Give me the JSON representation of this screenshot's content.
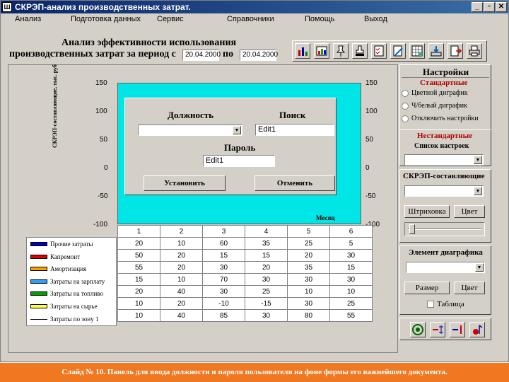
{
  "window": {
    "title": "СКРЭП-анализ производственных затрат.",
    "icon": "app-icon"
  },
  "menu": [
    "Анализ",
    "Подготовка данных",
    "Сервис",
    "Справочники",
    "Помощь",
    "Выход"
  ],
  "header": {
    "line1": "Анализ эффективности использования",
    "line2": "производственных затрат за период с",
    "to_label": "по",
    "date_from": "20.04.2000",
    "date_to": "20.04.2000"
  },
  "toolbar_icons": [
    "chart-bar-icon",
    "chart-color-icon",
    "pin-icon",
    "stamp-icon",
    "checklist-icon",
    "edit-doc-icon",
    "table-icon",
    "export-icon",
    "import-icon",
    "print-icon"
  ],
  "chart": {
    "ylabel": "СКРЭП-составляющие, тыс. руб",
    "xlabel": "Месяц",
    "yticks": [
      "150",
      "100",
      "50",
      "0",
      "-50",
      "-100"
    ],
    "yticks_right": [
      "150",
      "100",
      "50",
      "0",
      "-50",
      "-100"
    ]
  },
  "chart_data": {
    "type": "table",
    "x": [
      "1",
      "2",
      "3",
      "4",
      "5",
      "6"
    ],
    "series": [
      {
        "name": "Прочие затраты",
        "color": "#0000c0",
        "values": [
          20,
          10,
          60,
          35,
          25,
          5
        ]
      },
      {
        "name": "Капремонт",
        "color": "#e00000",
        "values": [
          50,
          20,
          15,
          15,
          20,
          30
        ]
      },
      {
        "name": "Амортизация",
        "color": "#ffa000",
        "values": [
          55,
          20,
          30,
          20,
          35,
          15
        ]
      },
      {
        "name": "Затраты на зарплату",
        "color": "#30a0ff",
        "values": [
          15,
          10,
          70,
          30,
          30,
          30
        ]
      },
      {
        "name": "Затраты на топливо",
        "color": "#00a000",
        "values": [
          20,
          40,
          30,
          25,
          10,
          10
        ]
      },
      {
        "name": "Затраты на сырье",
        "color": "#ffff40",
        "values": [
          10,
          20,
          -10,
          -15,
          30,
          25
        ]
      },
      {
        "name": "Затраты по зону 1",
        "color": "#000000",
        "values": [
          10,
          40,
          85,
          30,
          80,
          55
        ]
      }
    ]
  },
  "dialog": {
    "position_label": "Должность",
    "search_label": "Поиск",
    "search_value": "Edit1",
    "password_label": "Пароль",
    "password_value": "Edit1",
    "set_button": "Установить",
    "cancel_button": "Отменить"
  },
  "settings": {
    "title": "Настройки",
    "standard_label": "Стандартные",
    "radio1": "Цветной диграфик",
    "radio2": "Ч/белый диграфик",
    "radio3": "Отключить настройки",
    "nonstandard_label": "Нестандартные",
    "settings_list_label": "Список настроек",
    "components_label": "СКРЭП-составляющие",
    "hatch_button": "Штриховка",
    "color_button": "Цвет",
    "element_label": "Элемент диаграфика",
    "size_button": "Размер",
    "color_button2": "Цвет",
    "table_checkbox": "Таблица"
  },
  "footer": "Слайд № 10. Панель для ввода должности и пароля пользователя на фоне формы его важнейшего документа."
}
